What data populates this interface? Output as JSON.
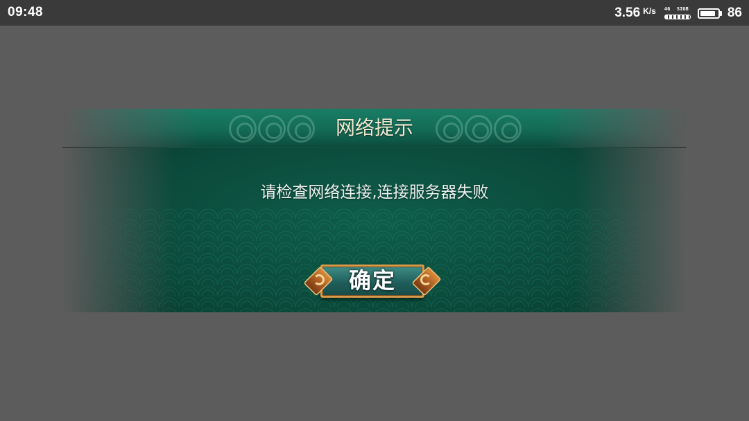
{
  "status_bar": {
    "time": "09:48",
    "net_speed": "3.56",
    "net_speed_unit": "K/s",
    "network_type": "4G",
    "sim_label": "SIGB",
    "battery_level": "86",
    "battery_fraction": 0.86
  },
  "dialog": {
    "title": "网络提示",
    "message": "请检查网络连接,连接服务器失败",
    "confirm_label": "确定"
  },
  "colors": {
    "backdrop": "#5c5c5c",
    "status_bar": "#3a3a3a",
    "dialog_green": "#0b4a3b",
    "title_text": "#f1ead0",
    "button_border": "#d79b4a"
  }
}
